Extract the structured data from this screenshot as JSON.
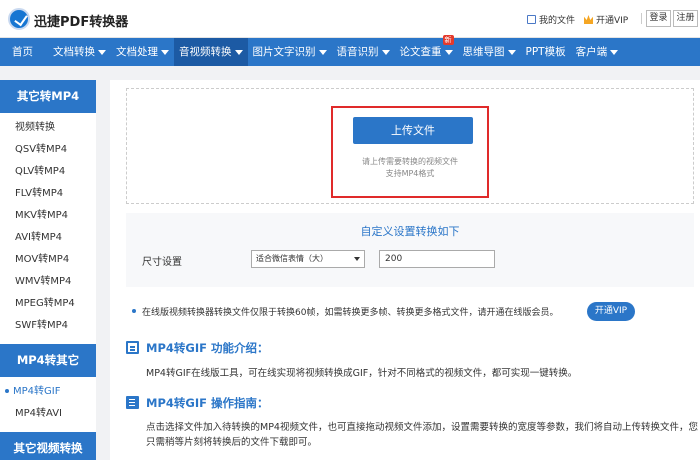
{
  "header": {
    "app_name": "迅捷PDF转换器",
    "my_docs": "我的文件",
    "open_vip": "开通VIP",
    "login": "登录",
    "register": "注册"
  },
  "nav": {
    "items": [
      {
        "label": "首页",
        "caret": false
      },
      {
        "label": "文档转换",
        "caret": true
      },
      {
        "label": "文档处理",
        "caret": true
      },
      {
        "label": "音视频转换",
        "caret": true,
        "active": true
      },
      {
        "label": "图片文字识别",
        "caret": true
      },
      {
        "label": "语音识别",
        "caret": true
      },
      {
        "label": "论文查重",
        "caret": true,
        "badge": "新"
      },
      {
        "label": "思维导图",
        "caret": true
      },
      {
        "label": "PPT模板",
        "caret": false
      },
      {
        "label": "客户端",
        "caret": true
      }
    ]
  },
  "sidebar": {
    "group1_title": "其它转MP4",
    "group1_items": [
      "视频转换",
      "QSV转MP4",
      "QLV转MP4",
      "FLV转MP4",
      "MKV转MP4",
      "AVI转MP4",
      "MOV转MP4",
      "WMV转MP4",
      "MPEG转MP4",
      "SWF转MP4"
    ],
    "group2_title": "MP4转其它",
    "group2_items": [
      "MP4转GIF",
      "MP4转AVI"
    ],
    "group2_selected_index": 0,
    "group3_title": "其它视频转换"
  },
  "upload": {
    "button_label": "上传文件",
    "hint_line1": "请上传需要转换的视频文件",
    "hint_line2": "支持MP4格式"
  },
  "settings": {
    "title": "自定义设置转换如下",
    "size_label": "尺寸设置",
    "size_option": "适合微信表情（大）",
    "size_value": "200"
  },
  "notice": {
    "text": "在线版视频转换器转换文件仅限于转换60帧，如需转换更多帧、转换更多格式文件，请开通在线版会员。",
    "vip_button": "开通VIP"
  },
  "intro": {
    "title": "MP4转GIF 功能介绍：",
    "body": "MP4转GIF在线版工具，可在线实现将视频转换成GIF，针对不同格式的视频文件，都可实现一键转换。"
  },
  "guide": {
    "title": "MP4转GIF 操作指南：",
    "body1": "点击选择文件加入待转换的MP4视频文件，也可直接拖动视频文件添加，设置需要转换的宽度等参数，我们将自动上传转换文件，您",
    "body2": "只需稍等片刻将转换后的文件下载即可。"
  },
  "colors": {
    "primary": "#2b76c8",
    "nav_active": "#1c5aa4",
    "highlight_border": "#e02a2a",
    "badge": "#e4392b",
    "vip_icon": "#f5a623"
  },
  "icons": {
    "logo": "app-logo-icon",
    "my_docs": "document-icon",
    "vip": "crown-icon",
    "intro_section": "intro-doc-icon",
    "guide_section": "guide-list-icon"
  }
}
